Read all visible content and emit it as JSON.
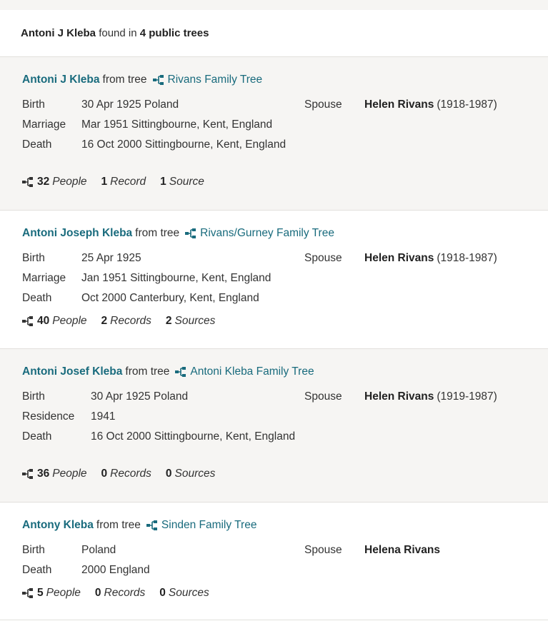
{
  "header": {
    "person": "Antoni J Kleba",
    "found_in": "found in",
    "count_text": "4 public trees"
  },
  "from_tree_label": "from tree",
  "trees": [
    {
      "person_name": "Antoni J Kleba",
      "tree_name": "Rivans Family Tree",
      "events": [
        {
          "label": "Birth",
          "value": "30 Apr 1925 Poland"
        },
        {
          "label": "Marriage",
          "value": "Mar 1951 Sittingbourne, Kent, England"
        },
        {
          "label": "Death",
          "value": "16 Oct 2000 Sittingbourne, Kent, England"
        }
      ],
      "spouse_label": "Spouse",
      "spouse_name": "Helen Rivans",
      "spouse_dates": "(1918-1987)",
      "people_count": "32",
      "people_label": "People",
      "records_count": "1",
      "records_label": "Record",
      "sources_count": "1",
      "sources_label": "Source"
    },
    {
      "person_name": "Antoni Joseph Kleba",
      "tree_name": "Rivans/Gurney Family Tree",
      "events": [
        {
          "label": "Birth",
          "value": "25 Apr 1925"
        },
        {
          "label": "Marriage",
          "value": "Jan 1951 Sittingbourne, Kent, England"
        },
        {
          "label": "Death",
          "value": "Oct 2000 Canterbury, Kent, England"
        }
      ],
      "spouse_label": "Spouse",
      "spouse_name": "Helen Rivans",
      "spouse_dates": "(1918-1987)",
      "people_count": "40",
      "people_label": "People",
      "records_count": "2",
      "records_label": "Records",
      "sources_count": "2",
      "sources_label": "Sources"
    },
    {
      "person_name": "Antoni Josef Kleba",
      "tree_name": "Antoni Kleba Family Tree",
      "events": [
        {
          "label": "Birth",
          "value": "30 Apr 1925 Poland"
        },
        {
          "label": "Residence",
          "value": "1941"
        },
        {
          "label": "Death",
          "value": "16 Oct 2000 Sittingbourne, Kent, England"
        }
      ],
      "spouse_label": "Spouse",
      "spouse_name": "Helen Rivans",
      "spouse_dates": "(1919-1987)",
      "people_count": "36",
      "people_label": "People",
      "records_count": "0",
      "records_label": "Records",
      "sources_count": "0",
      "sources_label": "Sources"
    },
    {
      "person_name": "Antony Kleba",
      "tree_name": "Sinden Family Tree",
      "events": [
        {
          "label": "Birth",
          "value": "Poland"
        },
        {
          "label": "Death",
          "value": "2000 England"
        }
      ],
      "spouse_label": "Spouse",
      "spouse_name": "Helena Rivans",
      "spouse_dates": "",
      "people_count": "5",
      "people_label": "People",
      "records_count": "0",
      "records_label": "Records",
      "sources_count": "0",
      "sources_label": "Sources"
    }
  ],
  "colors": {
    "link": "#196b7d",
    "shaded_bg": "#f6f5f3",
    "divider": "#e2e0dc"
  },
  "icons": {
    "tree": "family-tree-icon"
  }
}
